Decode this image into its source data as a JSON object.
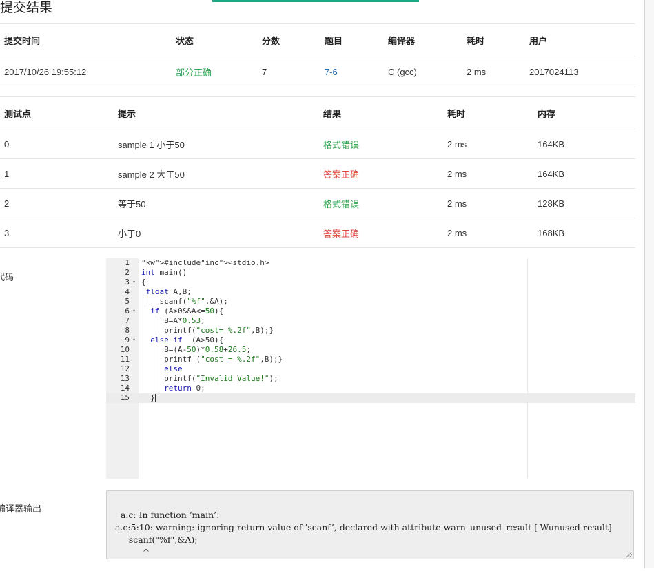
{
  "page": {
    "title": "提交结果"
  },
  "summary": {
    "headers": [
      "提交时间",
      "状态",
      "分数",
      "题目",
      "编译器",
      "耗时",
      "用户"
    ],
    "row": {
      "time": "2017/10/26 19:55:12",
      "status": "部分正确",
      "score": "7",
      "problem": "7-6",
      "compiler": "C (gcc)",
      "duration": "2 ms",
      "user": "2017024113"
    }
  },
  "tests": {
    "headers": [
      "测试点",
      "提示",
      "结果",
      "耗时",
      "内存"
    ],
    "rows": [
      {
        "id": "0",
        "hint": "sample 1 小于50",
        "result": "格式错误",
        "time": "2 ms",
        "memory": "164KB"
      },
      {
        "id": "1",
        "hint": "sample 2 大于50",
        "result": "答案正确",
        "time": "2 ms",
        "memory": "164KB"
      },
      {
        "id": "2",
        "hint": "等于50",
        "result": "格式错误",
        "time": "2 ms",
        "memory": "128KB"
      },
      {
        "id": "3",
        "hint": "小于0",
        "result": "答案正确",
        "time": "2 ms",
        "memory": "168KB"
      }
    ]
  },
  "code_section": {
    "label": "代码",
    "lines": [
      {
        "n": "1",
        "fold": "",
        "text": "#include<stdio.h>"
      },
      {
        "n": "2",
        "fold": "",
        "text": "int main()"
      },
      {
        "n": "3",
        "fold": "▾",
        "text": "{"
      },
      {
        "n": "4",
        "fold": "",
        "text": " float A,B;"
      },
      {
        "n": "5",
        "fold": "",
        "text": "    scanf(\"%f\",&A);"
      },
      {
        "n": "6",
        "fold": "▾",
        "text": "  if (A>0&&A<=50){"
      },
      {
        "n": "7",
        "fold": "",
        "text": "     B=A*0.53;"
      },
      {
        "n": "8",
        "fold": "",
        "text": "     printf(\"cost= %.2f\",B);}"
      },
      {
        "n": "9",
        "fold": "▾",
        "text": "  else if  (A>50){"
      },
      {
        "n": "10",
        "fold": "",
        "text": "     B=(A-50)*0.58+26.5;"
      },
      {
        "n": "11",
        "fold": "",
        "text": "     printf (\"cost = %.2f\",B);}"
      },
      {
        "n": "12",
        "fold": "",
        "text": "     else"
      },
      {
        "n": "13",
        "fold": "",
        "text": "     printf(\"Invalid Value!\");"
      },
      {
        "n": "14",
        "fold": "",
        "text": "     return 0;"
      },
      {
        "n": "15",
        "fold": "",
        "text": "  }"
      }
    ]
  },
  "compiler_section": {
    "label": "编译器输出",
    "output": "a.c: In function ’main’:\na.c:5:10: warning: ignoring return value of ’scanf’, declared with attribute warn_unused_result [-Wunused-result]\n     scanf(\"%f\",&A);\n          ^"
  },
  "colors": {
    "accent": "#20a884",
    "ok": "#2ea44f",
    "error": "#e0493f",
    "link": "#1f6fb8"
  }
}
